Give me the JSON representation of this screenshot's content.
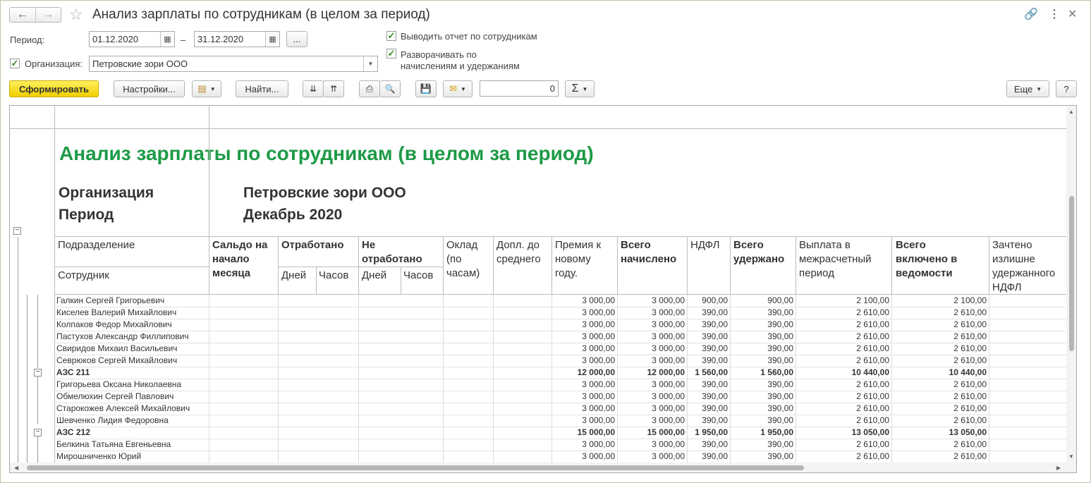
{
  "window": {
    "title": "Анализ зарплаты по сотрудникам (в целом за период)",
    "nav_back": "←",
    "nav_forward": "→"
  },
  "filters": {
    "period_label": "Период:",
    "date_from": "01.12.2020",
    "date_dash": "–",
    "date_to": "31.12.2020",
    "more_button": "...",
    "org_label": "Организация:",
    "org_value": "Петровские зори ООО",
    "org_checked": true,
    "check_by_employees": "Выводить отчет по сотрудникам",
    "check_expand": "Разворачивать по начислениям и удержаниям",
    "check_expand_line1": "Разворачивать по",
    "check_expand_line2": "начислениям и удержаниям"
  },
  "toolbar": {
    "generate": "Сформировать",
    "settings": "Настройки...",
    "find": "Найти...",
    "sum_value": "0",
    "sigma": "Σ",
    "more": "Еще",
    "help": "?"
  },
  "report": {
    "title": "Анализ зарплаты по сотрудникам (в целом за период)",
    "org_label": "Организация",
    "org_value": "Петровские зори ООО",
    "period_label": "Период",
    "period_value": "Декабрь 2020",
    "columns": {
      "division": "Подразделение",
      "employee": "Сотрудник",
      "saldo": [
        "Сальдо на",
        "начало",
        "месяца"
      ],
      "worked": "Отработано",
      "not_worked": [
        "Не",
        "отработано"
      ],
      "days": "Дней",
      "hours": "Часов",
      "salary": [
        "Оклад",
        "(по",
        "часам)"
      ],
      "addition": [
        "Допл. до",
        "среднего"
      ],
      "bonus": [
        "Премия к",
        "новому",
        "году."
      ],
      "total_accrued": [
        "Всего",
        "начислено"
      ],
      "ndfl": "НДФЛ",
      "total_withheld": [
        "Всего",
        "удержано"
      ],
      "interim_payment": [
        "Выплата в",
        "межрасчетный",
        "период"
      ],
      "total_in_statement": [
        "Всего",
        "включено в",
        "ведомости"
      ],
      "credited_excess": [
        "Зачтено",
        "излишне",
        "удержанного",
        "НДФЛ"
      ]
    },
    "rows": [
      {
        "type": "emp",
        "name": "Галкин Сергей Григорьевич",
        "bonus": "3 000,00",
        "accrued": "3 000,00",
        "ndfl": "900,00",
        "withheld": "900,00",
        "interim": "2 100,00",
        "statement": "2 100,00"
      },
      {
        "type": "emp",
        "name": "Киселев Валерий Михайлович",
        "bonus": "3 000,00",
        "accrued": "3 000,00",
        "ndfl": "390,00",
        "withheld": "390,00",
        "interim": "2 610,00",
        "statement": "2 610,00"
      },
      {
        "type": "emp",
        "name": "Колпаков Федор Михайлович",
        "bonus": "3 000,00",
        "accrued": "3 000,00",
        "ndfl": "390,00",
        "withheld": "390,00",
        "interim": "2 610,00",
        "statement": "2 610,00"
      },
      {
        "type": "emp",
        "name": "Пастухов Александр Филлипович",
        "bonus": "3 000,00",
        "accrued": "3 000,00",
        "ndfl": "390,00",
        "withheld": "390,00",
        "interim": "2 610,00",
        "statement": "2 610,00"
      },
      {
        "type": "emp",
        "name": "Свиридов Михаил Васильевич",
        "bonus": "3 000,00",
        "accrued": "3 000,00",
        "ndfl": "390,00",
        "withheld": "390,00",
        "interim": "2 610,00",
        "statement": "2 610,00"
      },
      {
        "type": "emp",
        "name": "Севрюков Сергей Михайлович",
        "bonus": "3 000,00",
        "accrued": "3 000,00",
        "ndfl": "390,00",
        "withheld": "390,00",
        "interim": "2 610,00",
        "statement": "2 610,00"
      },
      {
        "type": "group",
        "name": "АЗС 211",
        "bonus": "12 000,00",
        "accrued": "12 000,00",
        "ndfl": "1 560,00",
        "withheld": "1 560,00",
        "interim": "10 440,00",
        "statement": "10 440,00"
      },
      {
        "type": "emp",
        "name": "Григорьева Оксана Николаевна",
        "bonus": "3 000,00",
        "accrued": "3 000,00",
        "ndfl": "390,00",
        "withheld": "390,00",
        "interim": "2 610,00",
        "statement": "2 610,00"
      },
      {
        "type": "emp",
        "name": "Обмелюхин Сергей Павлович",
        "bonus": "3 000,00",
        "accrued": "3 000,00",
        "ndfl": "390,00",
        "withheld": "390,00",
        "interim": "2 610,00",
        "statement": "2 610,00"
      },
      {
        "type": "emp",
        "name": "Старокожев Алексей Михайлович",
        "bonus": "3 000,00",
        "accrued": "3 000,00",
        "ndfl": "390,00",
        "withheld": "390,00",
        "interim": "2 610,00",
        "statement": "2 610,00"
      },
      {
        "type": "emp",
        "name": "Шевченко Лидия Федоровна",
        "bonus": "3 000,00",
        "accrued": "3 000,00",
        "ndfl": "390,00",
        "withheld": "390,00",
        "interim": "2 610,00",
        "statement": "2 610,00"
      },
      {
        "type": "group",
        "name": "АЗС 212",
        "bonus": "15 000,00",
        "accrued": "15 000,00",
        "ndfl": "1 950,00",
        "withheld": "1 950,00",
        "interim": "13 050,00",
        "statement": "13 050,00"
      },
      {
        "type": "emp",
        "name": "Белкина Татьяна Евгеньевна",
        "bonus": "3 000,00",
        "accrued": "3 000,00",
        "ndfl": "390,00",
        "withheld": "390,00",
        "interim": "2 610,00",
        "statement": "2 610,00"
      },
      {
        "type": "emp",
        "name": "Мирошниченко Юрий",
        "bonus": "3 000,00",
        "accrued": "3 000,00",
        "ndfl": "390,00",
        "withheld": "390,00",
        "interim": "2 610,00",
        "statement": "2 610,00"
      }
    ]
  }
}
